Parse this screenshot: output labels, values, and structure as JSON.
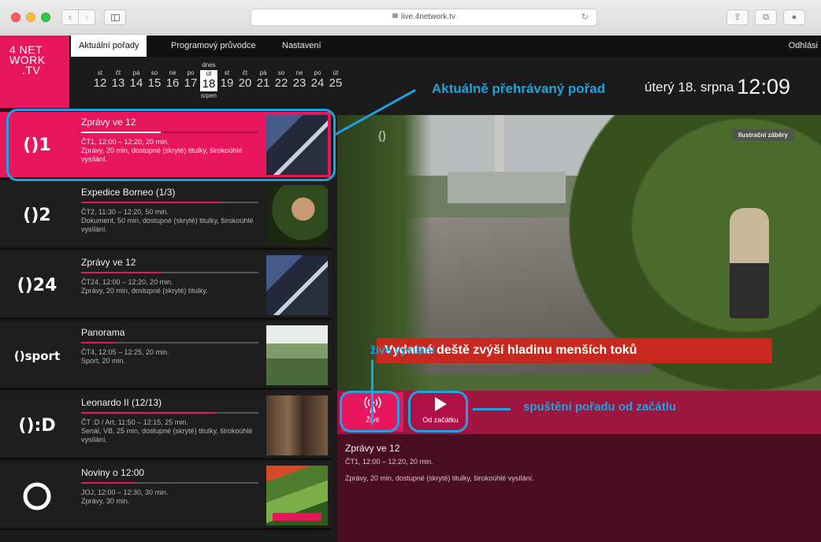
{
  "browser": {
    "url": "live.4network.tv",
    "colors": {
      "accent": "#e8175d",
      "annotation": "#1fa3e0"
    }
  },
  "logo": {
    "line1": "4 NET",
    "line2": "WORK",
    "line3": ".TV"
  },
  "nav": {
    "tabs": [
      "Aktuální pořady",
      "Programový průvodce",
      "Nastavení"
    ],
    "logout": "Odhlási"
  },
  "dates": [
    {
      "day": "st",
      "num": "12"
    },
    {
      "day": "čt",
      "num": "13"
    },
    {
      "day": "pá",
      "num": "14"
    },
    {
      "day": "so",
      "num": "15"
    },
    {
      "day": "ne",
      "num": "16"
    },
    {
      "day": "po",
      "num": "17"
    },
    {
      "day": "út",
      "num": "18",
      "today_label": "dnes",
      "month": "srpen"
    },
    {
      "day": "st",
      "num": "19"
    },
    {
      "day": "čt",
      "num": "20"
    },
    {
      "day": "pá",
      "num": "21"
    },
    {
      "day": "so",
      "num": "22"
    },
    {
      "day": "ne",
      "num": "23"
    },
    {
      "day": "po",
      "num": "24"
    },
    {
      "day": "út",
      "num": "25"
    }
  ],
  "header": {
    "date": "úterý 18. srpna",
    "time": "12:09"
  },
  "annotations": {
    "now_playing": "Aktuálně přehrávaný pořad",
    "live": "živé vysílání",
    "start": "spuštění pořadu od začátlu"
  },
  "channels": [
    {
      "logo": "()1",
      "title": "Zprávy ve 12",
      "meta": "ČT1, 12:00 – 12:20, 20 min.",
      "desc": "Zprávy, 20 min, dostupné (skryté) titulky, širokoúhlé vysílání.",
      "progress": 0.45
    },
    {
      "logo": "()2",
      "title": "Expedice Borneo (1/3)",
      "meta": "ČT2, 11:30 – 12:20, 50 min.",
      "desc": "Dokument, 50 min, dostupné (skryté) titulky, širokoúhlé vysílání.",
      "progress": 0.78
    },
    {
      "logo": "()24",
      "title": "Zprávy ve 12",
      "meta": "ČT24, 12:00 – 12:20, 20 min.",
      "desc": "Zprávy, 20 min, dostupné (skryté) titulky.",
      "progress": 0.45
    },
    {
      "logo": "()sport",
      "title": "Panorama",
      "meta": "ČT4, 12:05 – 12:25, 20 min.",
      "desc": "Sport, 20 min.",
      "progress": 0.2
    },
    {
      "logo": "():D",
      "title": "Leonardo II (12/13)",
      "meta": "ČT :D / Art, 11:50 – 12:15, 25 min.",
      "desc": "Seriál, VB, 25 min, dostupné (skryté) titulky, širokoúhlé vysílání.",
      "progress": 0.76
    },
    {
      "logo": "JOJ",
      "title": "Noviny o 12:00",
      "meta": "JOJ, 12:00 – 12:30, 30 min.",
      "desc": "Zprávy, 30 min.",
      "progress": 0.3
    }
  ],
  "video": {
    "channel_logo": "()",
    "tag": "Ilustrační záběry",
    "caption": "Vydatné deště zvýší hladinu menších toků"
  },
  "controls": {
    "live_label": "Živě",
    "start_label": "Od začátku"
  },
  "info": {
    "title": "Zprávy ve 12",
    "meta": "ČT1, 12:00 – 12:20, 20 min.",
    "desc": "Zprávy, 20 min, dostupné (skryté) titulky, širokoúhlé vysílání."
  }
}
